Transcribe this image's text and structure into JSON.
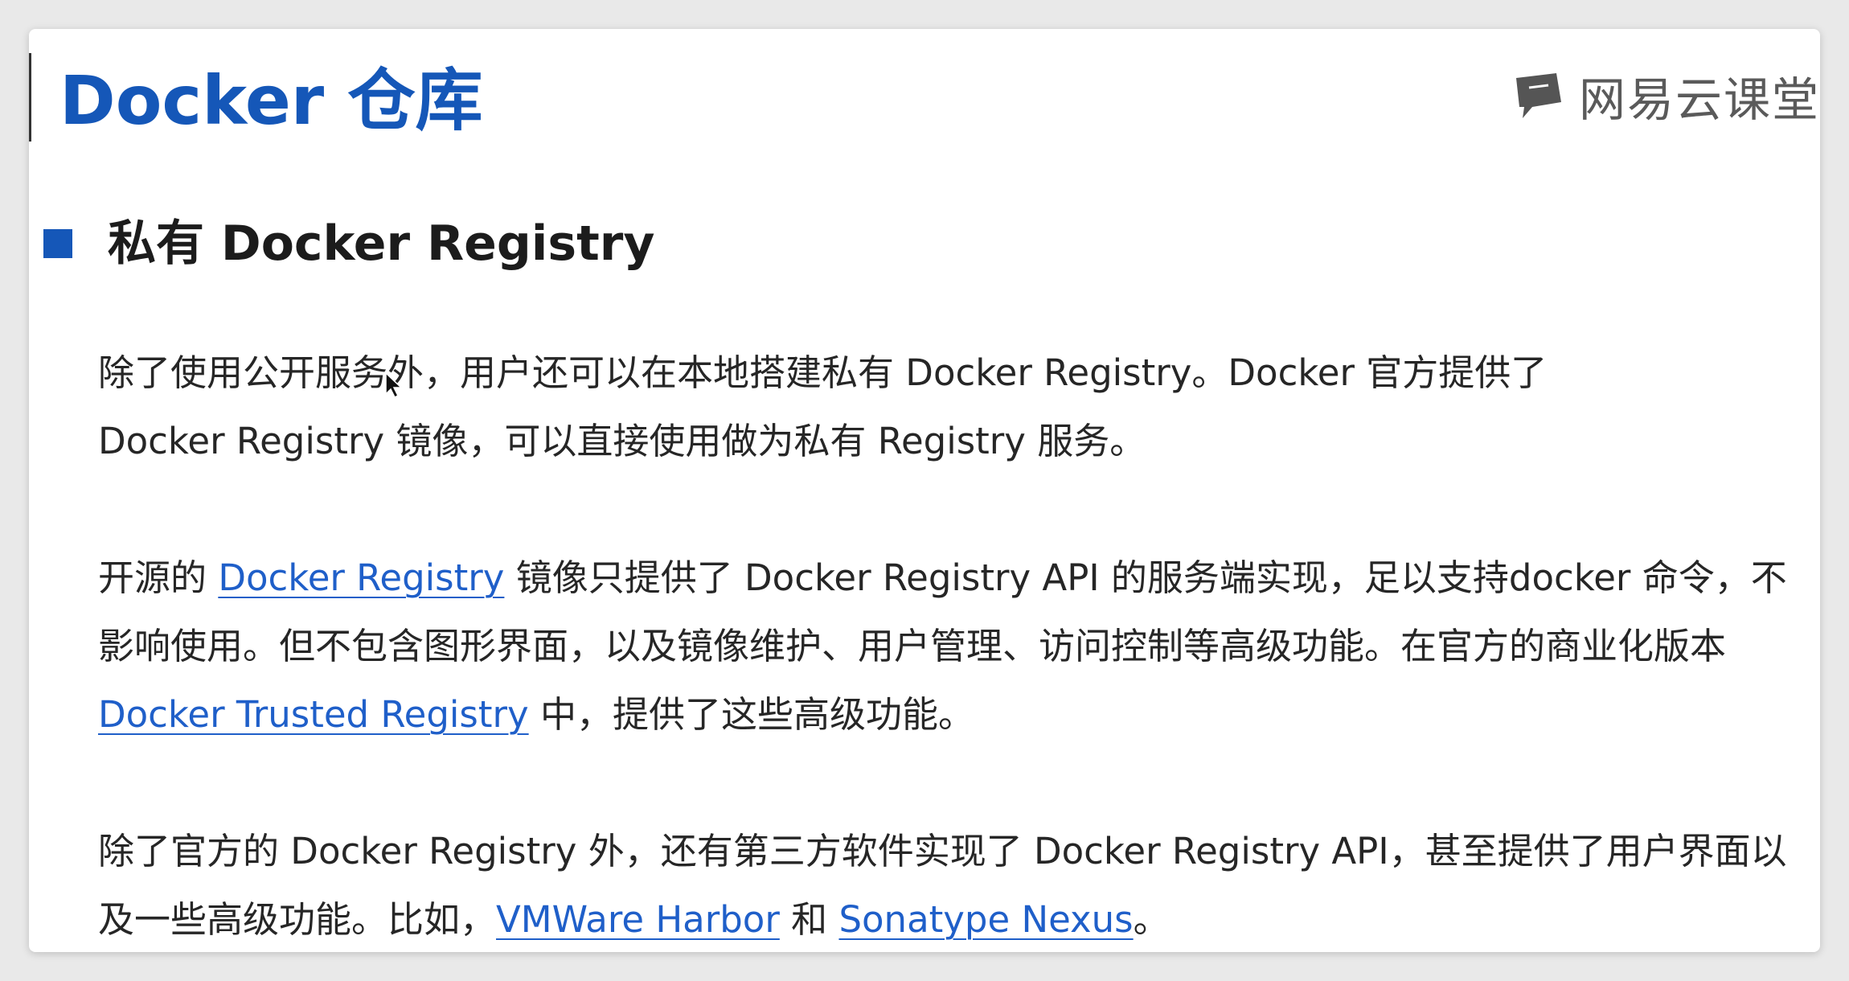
{
  "slide": {
    "title": "Docker 仓库",
    "brand": "网易云课堂",
    "brand_icon": "chat-bubble-icon",
    "accent_color": "#1557b8",
    "link_color": "#1f5fc9"
  },
  "section": {
    "title": "私有 Docker Registry"
  },
  "paragraphs": [
    {
      "lines": [
        [
          {
            "text": "除了使用公开服务外，用户还可以在本地搭建私有 Docker Registry。Docker 官方提供了"
          }
        ],
        [
          {
            "text": "Docker Registry 镜像，可以直接使用做为私有 Registry 服务。"
          }
        ]
      ]
    },
    {
      "lines": [
        [
          {
            "text": "开源的 "
          },
          {
            "text": "Docker Registry",
            "link": true
          },
          {
            "text": " 镜像只提供了 Docker Registry API 的服务端实现，足以支持docker 命令，不"
          }
        ],
        [
          {
            "text": "影响使用。但不包含图形界面，以及镜像维护、用户管理、访问控制等高级功能。在官方的商业化版本"
          }
        ],
        [
          {
            "text": "Docker Trusted Registry",
            "link": true
          },
          {
            "text": " 中，提供了这些高级功能。"
          }
        ]
      ]
    },
    {
      "lines": [
        [
          {
            "text": "除了官方的 Docker Registry 外，还有第三方软件实现了 Docker Registry API，甚至提供了用户界面以"
          }
        ],
        [
          {
            "text": "及一些高级功能。比如，"
          },
          {
            "text": "VMWare Harbor",
            "link": true
          },
          {
            "text": " 和 "
          },
          {
            "text": "Sonatype Nexus",
            "link": true
          },
          {
            "text": "。"
          }
        ]
      ]
    }
  ]
}
